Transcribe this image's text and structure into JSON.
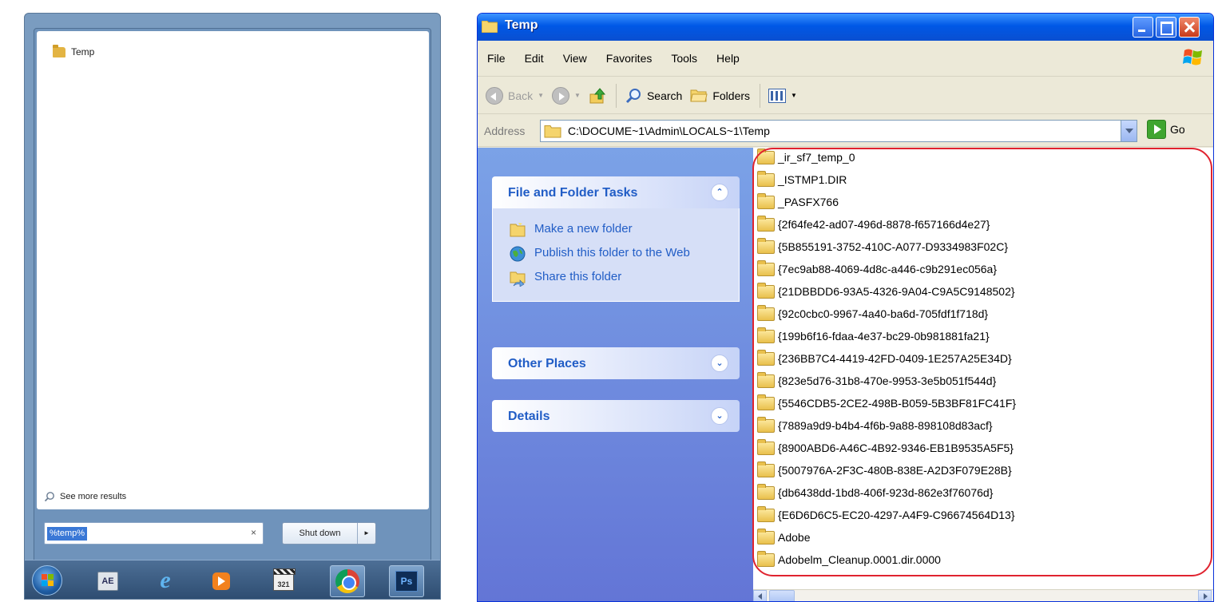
{
  "win7_start_menu": {
    "result_label": "Temp",
    "see_more": "See more results",
    "search_value": "%temp%",
    "clear_glyph": "×",
    "shutdown_label": "Shut down",
    "shutdown_arrow": "►",
    "taskbar": {
      "ae_label": "AE",
      "ie_glyph": "e",
      "clapper_label": "321",
      "ps_label": "Ps"
    }
  },
  "explorer": {
    "title": "Temp",
    "menus": [
      "File",
      "Edit",
      "View",
      "Favorites",
      "Tools",
      "Help"
    ],
    "toolbar": {
      "back": "Back",
      "search": "Search",
      "folders": "Folders"
    },
    "address": {
      "label": "Address",
      "value": "C:\\DOCUME~1\\Admin\\LOCALS~1\\Temp",
      "go": "Go"
    },
    "taskpane": {
      "file_folder_tasks": {
        "title": "File and Folder Tasks",
        "chevron": "⌃",
        "tasks": [
          "Make a new folder",
          "Publish this folder to the Web",
          "Share this folder"
        ]
      },
      "other_places": {
        "title": "Other Places",
        "chevron": "⌄"
      },
      "details": {
        "title": "Details",
        "chevron": "⌄"
      }
    },
    "files": [
      "_ir_sf7_temp_0",
      "_ISTMP1.DIR",
      "_PASFX766",
      "{2f64fe42-ad07-496d-8878-f657166d4e27}",
      "{5B855191-3752-410C-A077-D9334983F02C}",
      "{7ec9ab88-4069-4d8c-a446-c9b291ec056a}",
      "{21DBBDD6-93A5-4326-9A04-C9A5C9148502}",
      "{92c0cbc0-9967-4a40-ba6d-705fdf1f718d}",
      "{199b6f16-fdaa-4e37-bc29-0b981881fa21}",
      "{236BB7C4-4419-42FD-0409-1E257A25E34D}",
      "{823e5d76-31b8-470e-9953-3e5b051f544d}",
      "{5546CDB5-2CE2-498B-B059-5B3BF81FC41F}",
      "{7889a9d9-b4b4-4f6b-9a88-898108d83acf}",
      "{8900ABD6-A46C-4B92-9346-EB1B9535A5F5}",
      "{5007976A-2F3C-480B-838E-A2D3F079E28B}",
      "{db6438dd-1bd8-406f-923d-862e3f76076d}",
      "{E6D6D6C5-EC20-4297-A4F9-C96674564D13}",
      "Adobe",
      "Adobelm_Cleanup.0001.dir.0000"
    ]
  },
  "colors": {
    "xp_title_blue": "#0058e6",
    "xp_link_blue": "#215dc6",
    "highlight_red": "#e0232f",
    "win7_selection": "#3a78d6"
  }
}
